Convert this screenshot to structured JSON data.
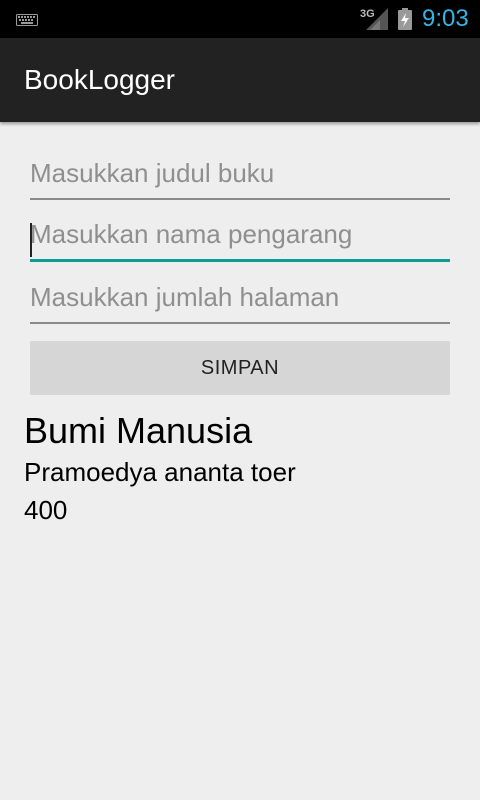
{
  "status_bar": {
    "network": "3G",
    "time": "9:03",
    "icons": [
      "keyboard-icon",
      "signal-icon",
      "battery-charging-icon"
    ],
    "time_color": "#33b5e5"
  },
  "app": {
    "title": "BookLogger"
  },
  "form": {
    "title_input": {
      "placeholder": "Masukkan judul buku",
      "value": ""
    },
    "author_input": {
      "placeholder": "Masukkan nama pengarang",
      "value": ""
    },
    "pages_input": {
      "placeholder": "Masukkan jumlah halaman",
      "value": ""
    },
    "save_label": "SIMPAN",
    "focus_color": "#0f9a94"
  },
  "book": {
    "title": "Bumi Manusia",
    "author": "Pramoedya ananta toer",
    "pages": "400"
  }
}
